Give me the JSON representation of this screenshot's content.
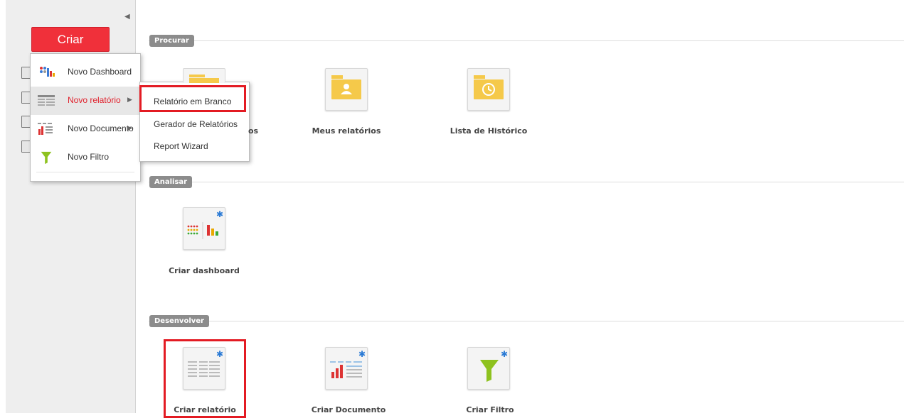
{
  "sidebar": {
    "create_label": "Criar",
    "collapse_icon": "triangle-left-icon"
  },
  "create_menu": {
    "items": [
      {
        "label": "Novo Dashboard",
        "icon": "dashboard-icon"
      },
      {
        "label": "Novo relatório",
        "icon": "report-icon",
        "submenu_icon": "chevron-right-icon",
        "active": true
      },
      {
        "label": "Novo Documento",
        "icon": "document-icon",
        "submenu_icon": "chevron-right-icon"
      },
      {
        "label": "Novo Filtro",
        "icon": "filter-icon"
      }
    ]
  },
  "report_submenu": {
    "items": [
      {
        "label": "Relatório em Branco",
        "highlighted": true
      },
      {
        "label": "Gerador de Relatórios"
      },
      {
        "label": "Report Wizard"
      }
    ]
  },
  "sections": {
    "browse": {
      "title": "Procurar",
      "tiles": [
        {
          "label": "os",
          "icon": "folder-icon"
        },
        {
          "label": "Meus relatórios",
          "icon": "user-folder-icon"
        },
        {
          "label": "Lista de Histórico",
          "icon": "history-folder-icon"
        }
      ]
    },
    "analyze": {
      "title": "Analisar",
      "tiles": [
        {
          "label": "Criar dashboard",
          "icon": "create-dashboard-icon"
        }
      ]
    },
    "develop": {
      "title": "Desenvolver",
      "tiles": [
        {
          "label": "Criar relatório",
          "icon": "create-report-icon",
          "highlighted": true
        },
        {
          "label": "Criar Documento",
          "icon": "create-document-icon"
        },
        {
          "label": "Criar Filtro",
          "icon": "create-filter-icon"
        }
      ]
    }
  },
  "colors": {
    "accent_red": "#e31b23",
    "create_button": "#f0303a",
    "folder_yellow": "#f5c94a",
    "badge_gray": "#8c8c8c"
  }
}
